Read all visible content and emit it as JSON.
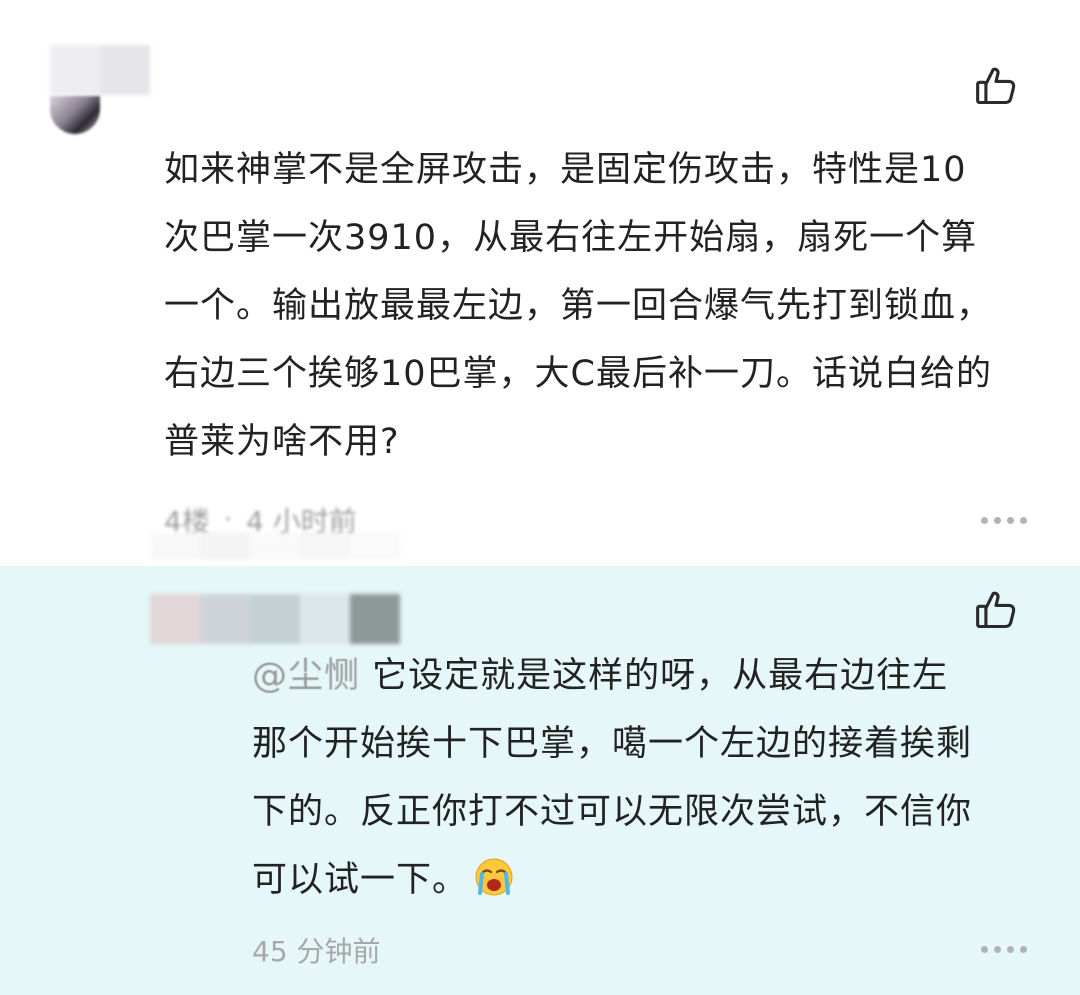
{
  "comment": {
    "text": "如来神掌不是全屏攻击，是固定伤攻击，特性是10\n次巴掌一次3910，从最右往左开始扇，扇死一个算\n一个。输出放最最左边，第一回合爆气先打到锁血，\n右边三个挨够10巴掌，大C最后补一刀。话说白给的\n普莱为啥不用?",
    "floor": "4楼",
    "separator": "·",
    "time": "4 小时前",
    "like_icon": "thumbs-up-outline-icon",
    "more_icon": "more-horizontal-icon"
  },
  "reply": {
    "mention": "@尘恻",
    "text_first": "  它设定就是这样的呀，从最右边往左\n那个开始挨十下巴掌，噶一个左边的接着挨剩\n下的。反正你打不过可以无限次尝试，不信你\n可以试一下。",
    "emoji_icon": "loudly-crying-face-icon",
    "time": "45 分钟前",
    "like_icon": "thumbs-up-outline-icon",
    "more_icon": "more-horizontal-icon"
  },
  "colors": {
    "reply_background": "#e5f7f8",
    "meta_text": "#a8a8a8",
    "body_text": "#222222"
  }
}
